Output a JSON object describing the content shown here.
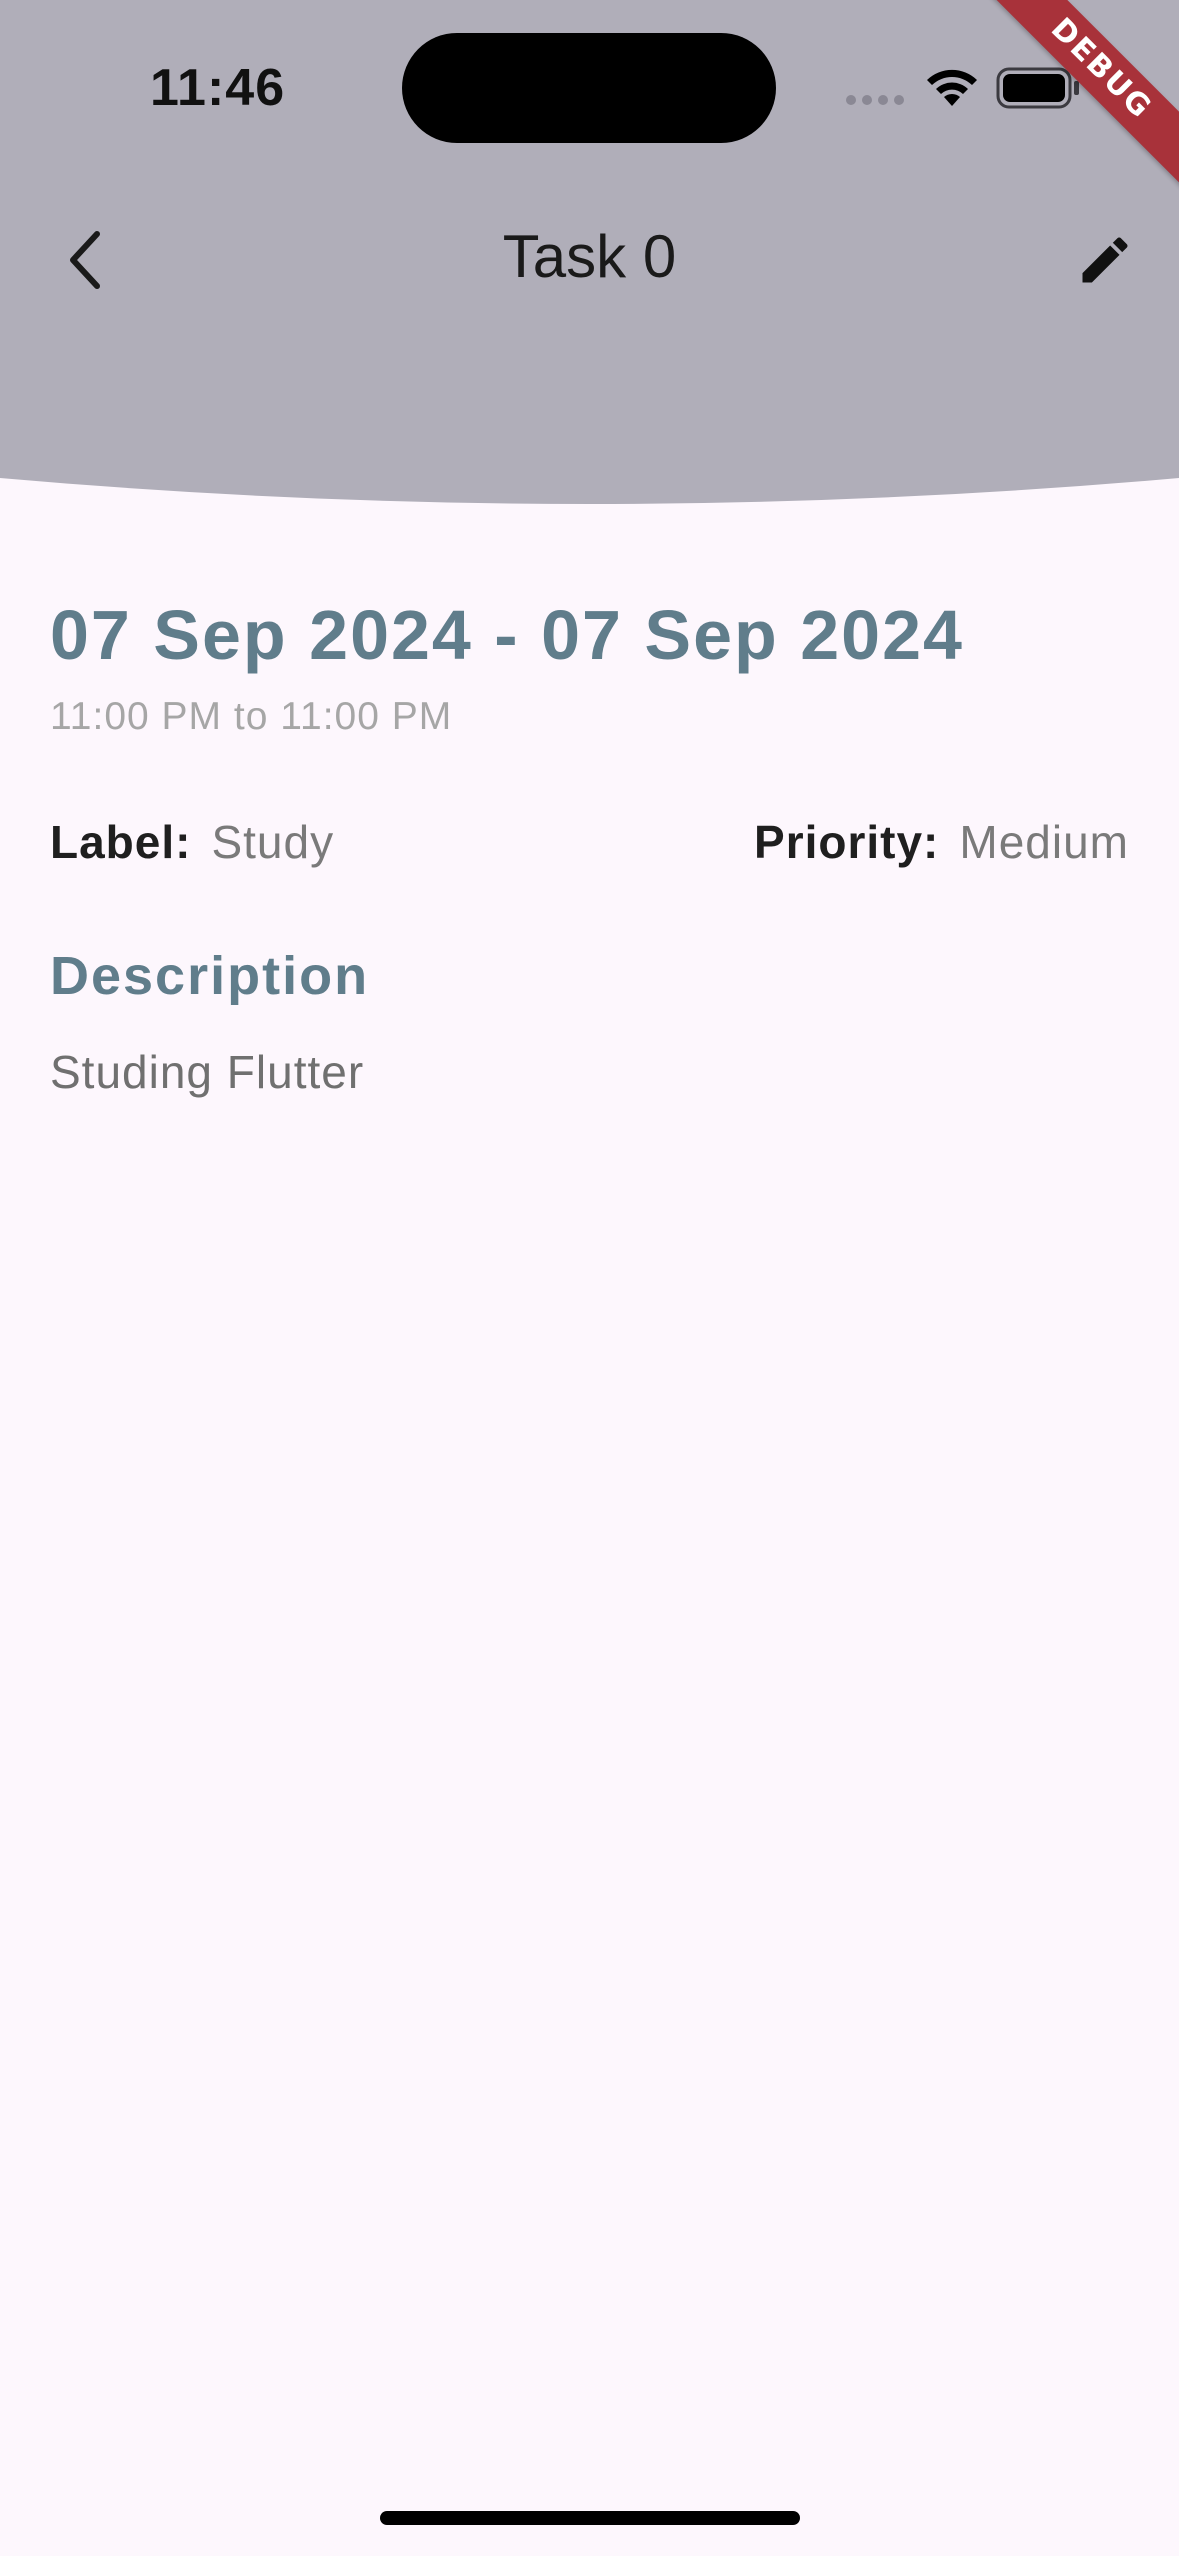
{
  "status_bar": {
    "time": "11:46"
  },
  "debug_banner": "DEBUG",
  "app_bar": {
    "title": "Task 0",
    "back_icon": "chevron-left-icon",
    "edit_icon": "pencil-icon",
    "background_color": "#b0aeb9"
  },
  "task": {
    "date_range": "07 Sep 2024 - 07 Sep 2024",
    "time_range": "11:00 PM to 11:00 PM",
    "label_key": "Label:",
    "label_value": "Study",
    "priority_key": "Priority:",
    "priority_value": "Medium",
    "description_heading": "Description",
    "description": "Studing Flutter"
  },
  "colors": {
    "accent": "#607d8b",
    "page_background": "#fdf7fd"
  }
}
